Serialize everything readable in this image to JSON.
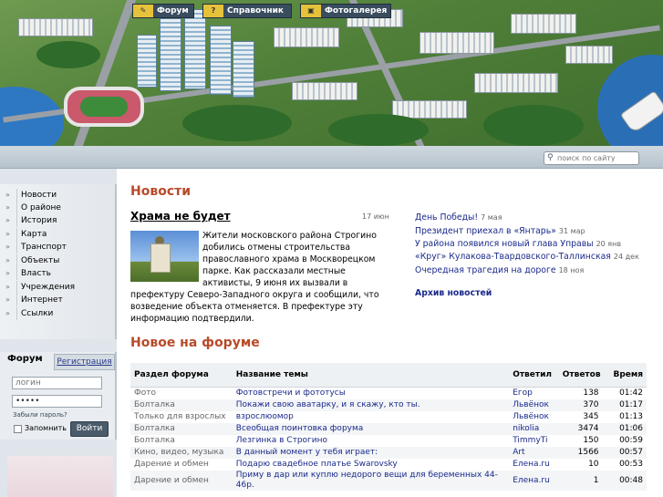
{
  "nav": {
    "tabs": [
      {
        "label": "Форум",
        "icon": "chat-icon"
      },
      {
        "label": "Справочник",
        "icon": "question-icon"
      },
      {
        "label": "Фотогалерея",
        "icon": "camera-icon"
      }
    ],
    "search_placeholder": "поиск по сайту"
  },
  "sidebar": {
    "menu": [
      "Новости",
      "О районе",
      "История",
      "Карта",
      "Транспорт",
      "Объекты",
      "Власть",
      "Учреждения",
      "Интернет",
      "Ссылки"
    ],
    "login": {
      "tab_forum": "Форум",
      "tab_register": "Регистрация",
      "login_placeholder": "логин",
      "password_value": "•••••",
      "forgot": "Забыли пароль?",
      "remember": "Запомнить",
      "submit": "Войти"
    }
  },
  "news": {
    "section_title": "Новости",
    "headline": "Храма не будет",
    "date": "17 июн",
    "text": "Жители московского района Строгино добились отмены строительства православного храма в Москворецком парке. Как рассказали местные активисты, 9 июня их вызвали в префектуру Северо-Западного округа и сообщили, что возведение объекта отменяется. В префектуре эту информацию подтвердили.",
    "items": [
      {
        "title": "День Победы!",
        "date": "7 мая"
      },
      {
        "title": "Президент приехал в «Янтарь»",
        "date": "31 мар"
      },
      {
        "title": "У района появился новый глава Управы",
        "date": "20 янв"
      },
      {
        "title": "«Круг» Кулакова-Твардовского-Таллинская",
        "date": "24 дек"
      },
      {
        "title": "Очередная трагедия на дороге",
        "date": "18 ноя"
      }
    ],
    "archive": "Архив новостей"
  },
  "forum": {
    "section_title": "Новое на форуме",
    "headers": [
      "Раздел форума",
      "Название темы",
      "Ответил",
      "Ответов",
      "Время"
    ],
    "rows": [
      {
        "section": "Фото",
        "topic": "Фотовстречи и фототусы",
        "user": "Егор",
        "replies": "138",
        "time": "01:42"
      },
      {
        "section": "Болталка",
        "topic": "Покажи свою аватарку, и я скажу, кто ты.",
        "user": "Львёнок",
        "replies": "370",
        "time": "01:17"
      },
      {
        "section": "Только для взрослых",
        "topic": "взрослюомор",
        "user": "Львёнок",
        "replies": "345",
        "time": "01:13"
      },
      {
        "section": "Болталка",
        "topic": "Всеобщая поинтовка форума",
        "user": "nikolia",
        "replies": "3474",
        "time": "01:06"
      },
      {
        "section": "Болталка",
        "topic": "Лезгинка в Строгино",
        "user": "TimmyTi",
        "replies": "150",
        "time": "00:59"
      },
      {
        "section": "Кино, видео, музыка",
        "topic": "В данный момент у тебя играет:",
        "user": "Art",
        "replies": "1566",
        "time": "00:57"
      },
      {
        "section": "Дарение и обмен",
        "topic": "Подарю свадебное платье Swarovsky",
        "user": "Елена.ru",
        "replies": "10",
        "time": "00:53"
      },
      {
        "section": "Дарение и обмен",
        "topic": "Приму в дар или куплю недорого вещи для беременных 44-46р.",
        "user": "Елена.ru",
        "replies": "1",
        "time": "00:48"
      }
    ]
  }
}
